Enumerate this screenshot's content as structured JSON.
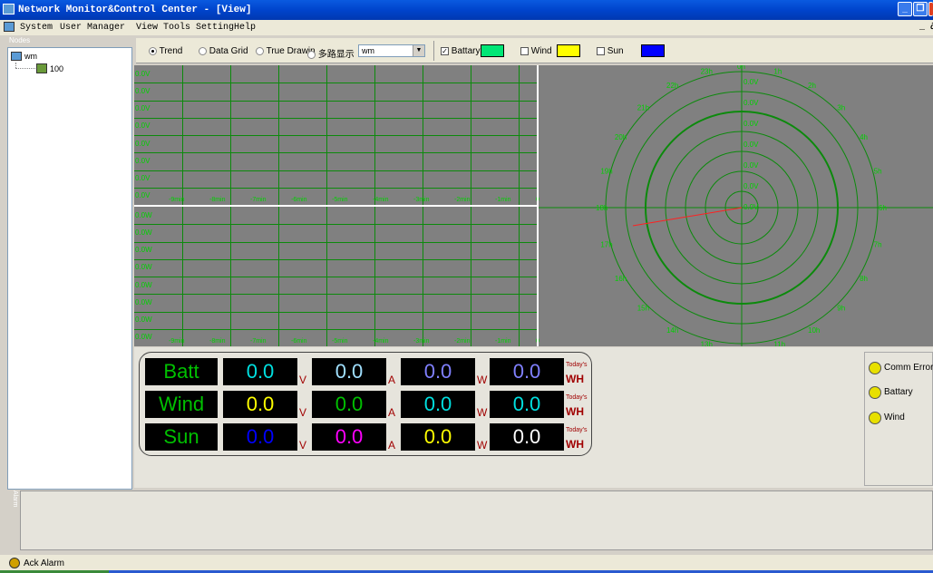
{
  "window": {
    "title": "Network Monitor&Control Center - [View]"
  },
  "menu": {
    "items": [
      "System",
      "User Manager",
      "View",
      "Tools",
      "Setting",
      "Help"
    ]
  },
  "left_panel": {
    "caption": "Nodes",
    "root_label": "wm",
    "child_label": "100"
  },
  "toolbar": {
    "trend_label": "Trend",
    "datagrid_label": "Data Grid",
    "truedraw_label": "True Drawin",
    "multi_label": "多路显示",
    "combo_value": "wm",
    "battery_label": "Battary",
    "wind_label": "Wind",
    "sun_label": "Sun",
    "battery_color": "#00e676",
    "wind_color": "#ffff00",
    "sun_color": "#0000ff"
  },
  "trend_top": {
    "ylabels": [
      "0.0V",
      "0.0V",
      "0.0V",
      "0.0V",
      "0.0V",
      "0.0V",
      "0.0V",
      "0.0V"
    ],
    "xlabels": [
      "-9min",
      "-8min",
      "-7min",
      "-6min",
      "-5min",
      "-4min",
      "-3min",
      "-2min",
      "-1min",
      "0"
    ]
  },
  "trend_bottom": {
    "ylabels": [
      "0.0W",
      "0.0W",
      "0.0W",
      "0.0W",
      "0.0W",
      "0.0W",
      "0.0W",
      "0.0W"
    ],
    "xlabels": [
      "-9min",
      "-8min",
      "-7min",
      "-6min",
      "-5min",
      "-4min",
      "-3min",
      "-2min",
      "-1min",
      "0"
    ]
  },
  "polar": {
    "hours": [
      "0h",
      "1h",
      "2h",
      "3h",
      "4h",
      "5h",
      "6h",
      "7h",
      "8h",
      "9h",
      "10h",
      "11h",
      "12h",
      "13h",
      "14h",
      "15h",
      "16h",
      "17h",
      "18h",
      "19h",
      "20h",
      "21h",
      "22h",
      "23h"
    ],
    "ring_labels": [
      "0.0V",
      "0.0V",
      "0.0V",
      "0.0V",
      "0.0V",
      "0.0V",
      "0.0V"
    ]
  },
  "meters": {
    "today_label": "Today's",
    "rows": [
      {
        "name": "Batt",
        "name_color": "#00c000",
        "v": "0.0",
        "a": "0.0",
        "w": "0.0",
        "wh": "0.0",
        "v_color": "#00e0e0",
        "a_color": "#a0e0ff",
        "w_color": "#8080ff",
        "wh_color": "#8080ff"
      },
      {
        "name": "Wind",
        "name_color": "#00c000",
        "v": "0.0",
        "a": "0.0",
        "w": "0.0",
        "wh": "0.0",
        "v_color": "#ffff00",
        "a_color": "#00c000",
        "w_color": "#00e0e0",
        "wh_color": "#00e0e0"
      },
      {
        "name": "Sun",
        "name_color": "#00c000",
        "v": "0.0",
        "a": "0.0",
        "w": "0.0",
        "wh": "0.0",
        "v_color": "#0000ff",
        "a_color": "#ff00ff",
        "w_color": "#ffff00",
        "wh_color": "#ffffff"
      }
    ],
    "units": {
      "v": "V",
      "a": "A",
      "w": "W",
      "wh": "WH"
    }
  },
  "alarms": {
    "items": [
      "Comm Error",
      "Battary",
      "Wind"
    ]
  },
  "log_panel": {
    "caption": "Alarm"
  },
  "statusbar": {
    "ack_label": "Ack Alarm"
  }
}
